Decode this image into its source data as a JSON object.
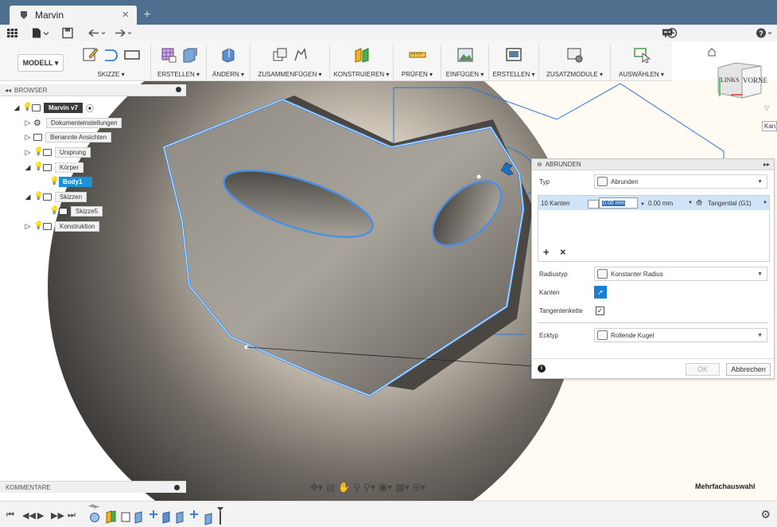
{
  "app": {
    "tab_title": "Marvin",
    "new_tab": "+"
  },
  "ribbon": {
    "mode": "MODELL ▾",
    "groups": [
      {
        "label": "SKIZZE ▾"
      },
      {
        "label": "ERSTELLEN ▾"
      },
      {
        "label": "ÄNDERN ▾"
      },
      {
        "label": "ZUSAMMENFÜGEN ▾"
      },
      {
        "label": "KONSTRUIEREN ▾"
      },
      {
        "label": "PRÜFEN ▾"
      },
      {
        "label": "EINFÜGEN ▾"
      },
      {
        "label": "ERSTELLEN ▾"
      },
      {
        "label": "ZUSATZMODULE ▾"
      },
      {
        "label": "AUSWÄHLEN ▾"
      }
    ]
  },
  "browser": {
    "title": "BROWSER",
    "items": [
      {
        "label": "Marvin v7"
      },
      {
        "label": "Dokumenteinstellungen"
      },
      {
        "label": "Benannte Ansichten"
      },
      {
        "label": "Ursprung"
      },
      {
        "label": "Körper"
      },
      {
        "label": "Body1"
      },
      {
        "label": "Skizzen"
      },
      {
        "label": "Skizze5"
      },
      {
        "label": "Konstruktion"
      }
    ]
  },
  "viewcube": {
    "left": "LINKS",
    "front": "VORNE",
    "edge_label": "Kan"
  },
  "dialog": {
    "title": "ABRUNDEN",
    "typ_label": "Typ",
    "typ_value": "Abrunden",
    "edges_label": "10 Kanten",
    "radius_input": "0.00 mm",
    "radius_value": "0.00 mm",
    "continuity": "Tangential (G1)",
    "add": "+",
    "remove": "×",
    "radius_type_label": "Radiustyp",
    "radius_type_value": "Konstanter Radius",
    "kanten_label": "Kanten",
    "tangent_chain_label": "Tangentenkette",
    "corner_label": "Ecktyp",
    "corner_value": "Rollende Kugel",
    "ok": "OK",
    "cancel": "Abbrechen"
  },
  "comments": {
    "title": "KOMMENTARE"
  },
  "status": {
    "selection_mode": "Mehrfachauswahl"
  }
}
